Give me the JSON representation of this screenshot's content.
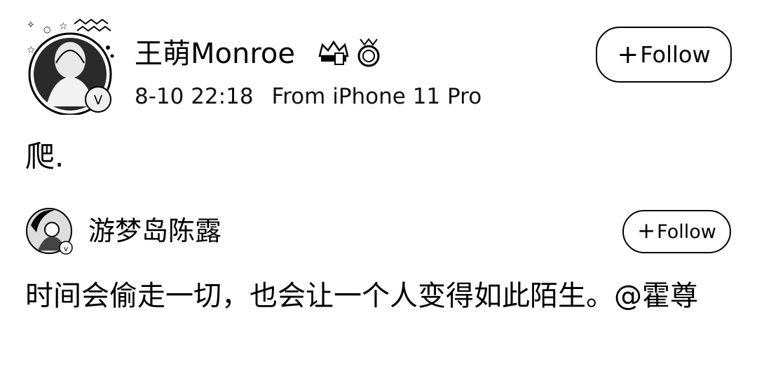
{
  "post1": {
    "author": "王萌Monroe",
    "timestamp": "8-10 22:18",
    "source": "From iPhone 11 Pro",
    "follow_label": "Follow",
    "text": "爬."
  },
  "post2": {
    "author": "游梦岛陈露",
    "follow_label": "Follow",
    "text": "时间会偷走一切，也会让一个人变得如此陌生。@霍尊"
  },
  "icons": {
    "badge1": "crown-badge-icon",
    "badge2": "medal-badge-icon",
    "verified": "verified-v-icon",
    "plus": "plus-icon"
  }
}
